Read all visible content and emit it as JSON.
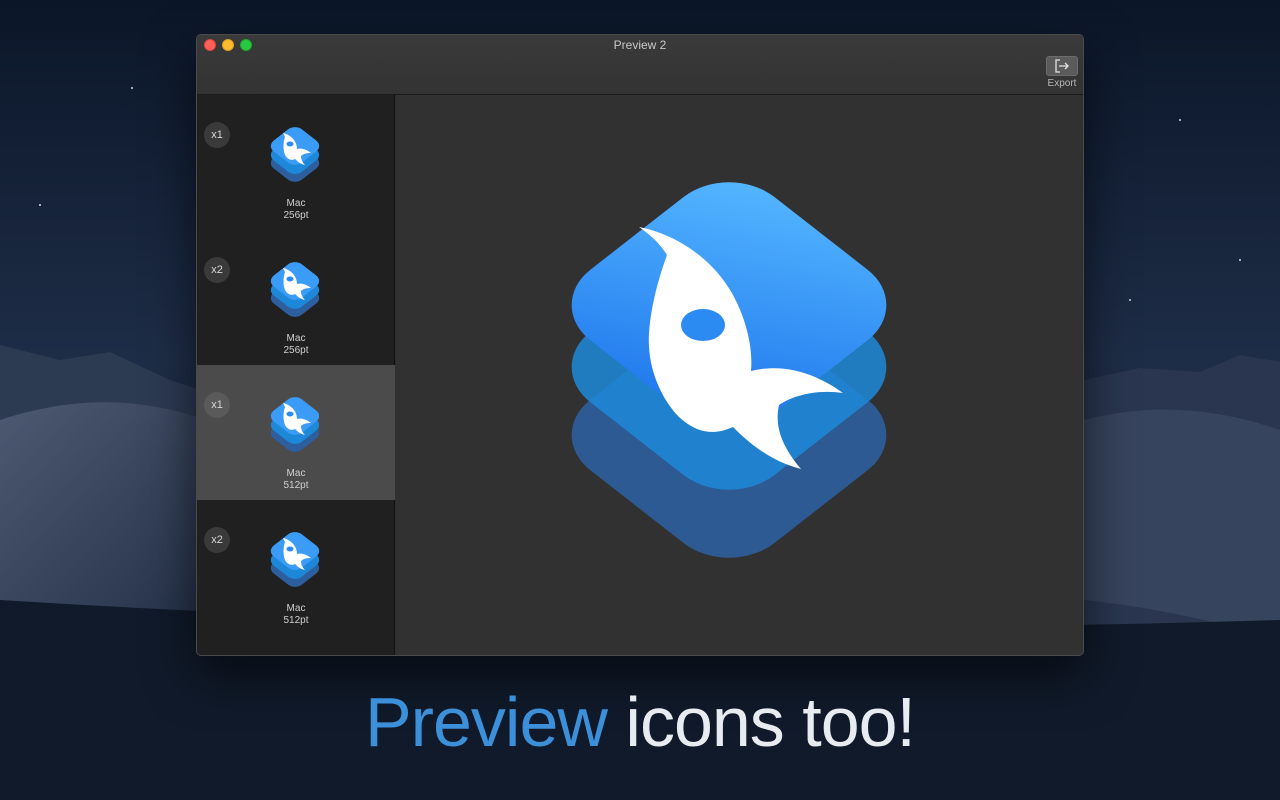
{
  "window": {
    "title": "Preview 2",
    "export_label": "Export"
  },
  "sidebar": {
    "items": [
      {
        "scale": "x1",
        "platform": "Mac",
        "size": "256pt",
        "selected": false
      },
      {
        "scale": "x2",
        "platform": "Mac",
        "size": "256pt",
        "selected": false
      },
      {
        "scale": "x1",
        "platform": "Mac",
        "size": "512pt",
        "selected": true
      },
      {
        "scale": "x2",
        "platform": "Mac",
        "size": "512pt",
        "selected": false
      }
    ]
  },
  "tagline": {
    "accent": "Preview",
    "rest": " icons too!"
  },
  "icons": {
    "export": "export-icon",
    "app": "rocket-app-icon"
  },
  "colors": {
    "accent": "#3c8fd9",
    "icon_top": "#3b9cf7",
    "selected_row": "#4b4b4b"
  }
}
